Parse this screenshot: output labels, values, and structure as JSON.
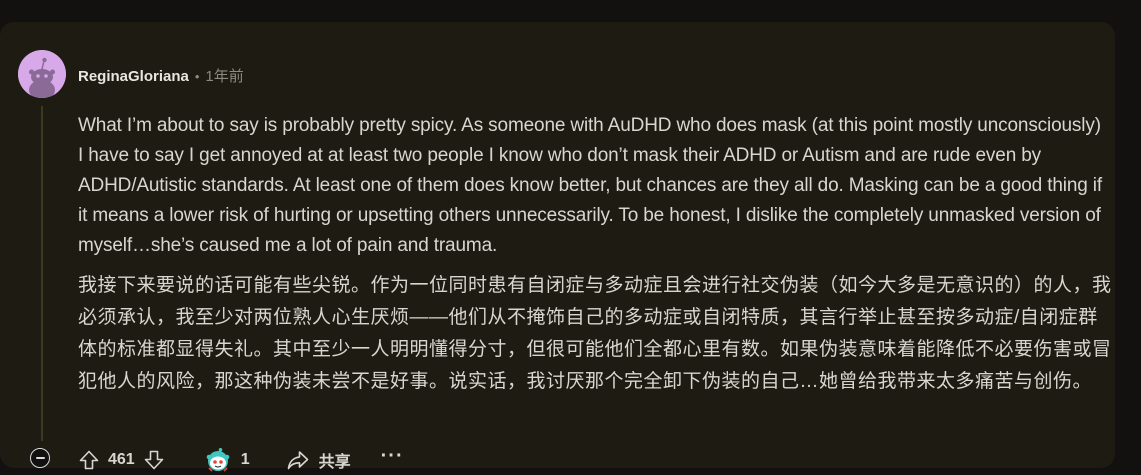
{
  "comment": {
    "username": "ReginaGloriana",
    "separator": "•",
    "time": "1年前",
    "body_en": "What I’m about to say is probably pretty spicy. As someone with AuDHD who does mask (at this point mostly unconsciously) I have to say I get annoyed at at least two people I know who don’t mask their ADHD or Autism and are rude even by ADHD/Autistic standards. At least one of them does know better, but chances are they all do. Masking can be a good thing if it means a lower risk of hurting or upsetting others unnecessarily. To be honest, I dislike the completely unmasked version of myself…she’s caused me a lot of pain and trauma.",
    "body_zh": "我接下来要说的话可能有些尖锐。作为一位同时患有自闭症与多动症且会进行社交伪装（如今大多是无意识的）的人，我必须承认，我至少对两位熟人心生厌烦——他们从不掩饰自己的多动症或自闭特质，其言行举止甚至按多动症/自闭症群体的标准都显得失礼。其中至少一人明明懂得分寸，但很可能他们全都心里有数。如果伪装意味着能降低不必要伤害或冒犯他人的风险，那这种伪装未尝不是好事。说实话，我讨厌那个完全卸下伪装的自己…她曾给我带来太多痛苦与创伤。"
  },
  "actions": {
    "upvote_icon": "upvote-arrow-icon",
    "vote_count": "461",
    "downvote_icon": "downvote-arrow-icon",
    "award_icon": "award-snoo-icon",
    "award_count": "1",
    "share_icon": "share-arrow-icon",
    "share_label": "共享",
    "more_label": "···"
  },
  "colors": {
    "card_bg": "#1d1b12",
    "page_bg": "#131110",
    "text": "#d8d6cf",
    "meta": "#8a8a80",
    "avatar_bg": "#d7a9e8"
  }
}
